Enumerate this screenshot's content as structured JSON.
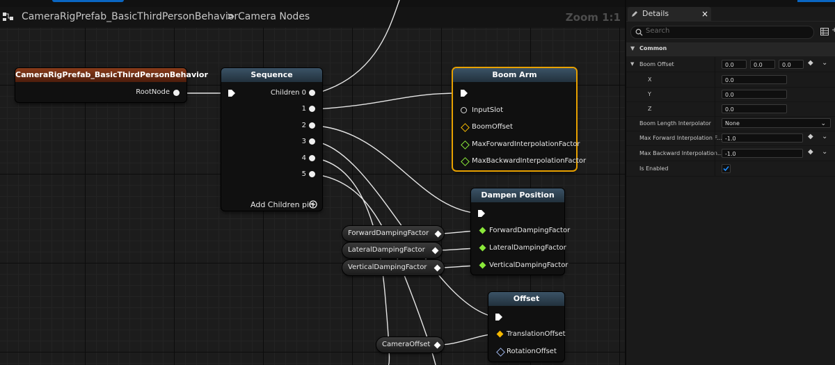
{
  "graph": {
    "breadcrumb": {
      "asset": "CameraRigPrefab_BasicThirdPersonBehavior",
      "separator": ">",
      "graph": "Camera Nodes"
    },
    "zoom_label": "Zoom 1:1",
    "nodes": {
      "root": {
        "title": "CameraRigPrefab_BasicThirdPersonBehavior",
        "pin_root": "RootNode"
      },
      "sequence": {
        "title": "Sequence",
        "pins": [
          "Children 0",
          "1",
          "2",
          "3",
          "4",
          "5"
        ],
        "add_pin": "Add Children pin"
      },
      "boom_arm": {
        "title": "Boom Arm",
        "pins": [
          "InputSlot",
          "BoomOffset",
          "MaxForwardInterpolationFactor",
          "MaxBackwardInterpolationFactor"
        ]
      },
      "dampen_position": {
        "title": "Dampen Position",
        "pins": [
          "ForwardDampingFactor",
          "LateralDampingFactor",
          "VerticalDampingFactor"
        ]
      },
      "offset": {
        "title": "Offset",
        "pins": [
          "TranslationOffset",
          "RotationOffset"
        ]
      }
    },
    "variables": [
      "ForwardDampingFactor",
      "LateralDampingFactor",
      "VerticalDampingFactor",
      "CameraOffset"
    ]
  },
  "details": {
    "tab_label": "Details",
    "search_placeholder": "Search",
    "category": "Common",
    "boom_offset": {
      "label": "Boom Offset",
      "x": "0.0",
      "y": "0.0",
      "z": "0.0",
      "x_label": "X",
      "y_label": "Y",
      "z_label": "Z"
    },
    "boom_length_interpolator": {
      "label": "Boom Length Interpolator",
      "value": "None"
    },
    "max_forward": {
      "label": "Max Forward Interpolation F...",
      "value": "-1.0"
    },
    "max_backward": {
      "label": "Max Backward Interpolation...",
      "value": "-1.0"
    },
    "is_enabled": {
      "label": "Is Enabled",
      "checked": true
    }
  },
  "colors": {
    "selection": "#e8a100",
    "struct_pin": "#f5b800",
    "float_pin": "#8ae83a",
    "rotator_pin": "#9db4e8",
    "accent_blue": "#0a66c2"
  }
}
